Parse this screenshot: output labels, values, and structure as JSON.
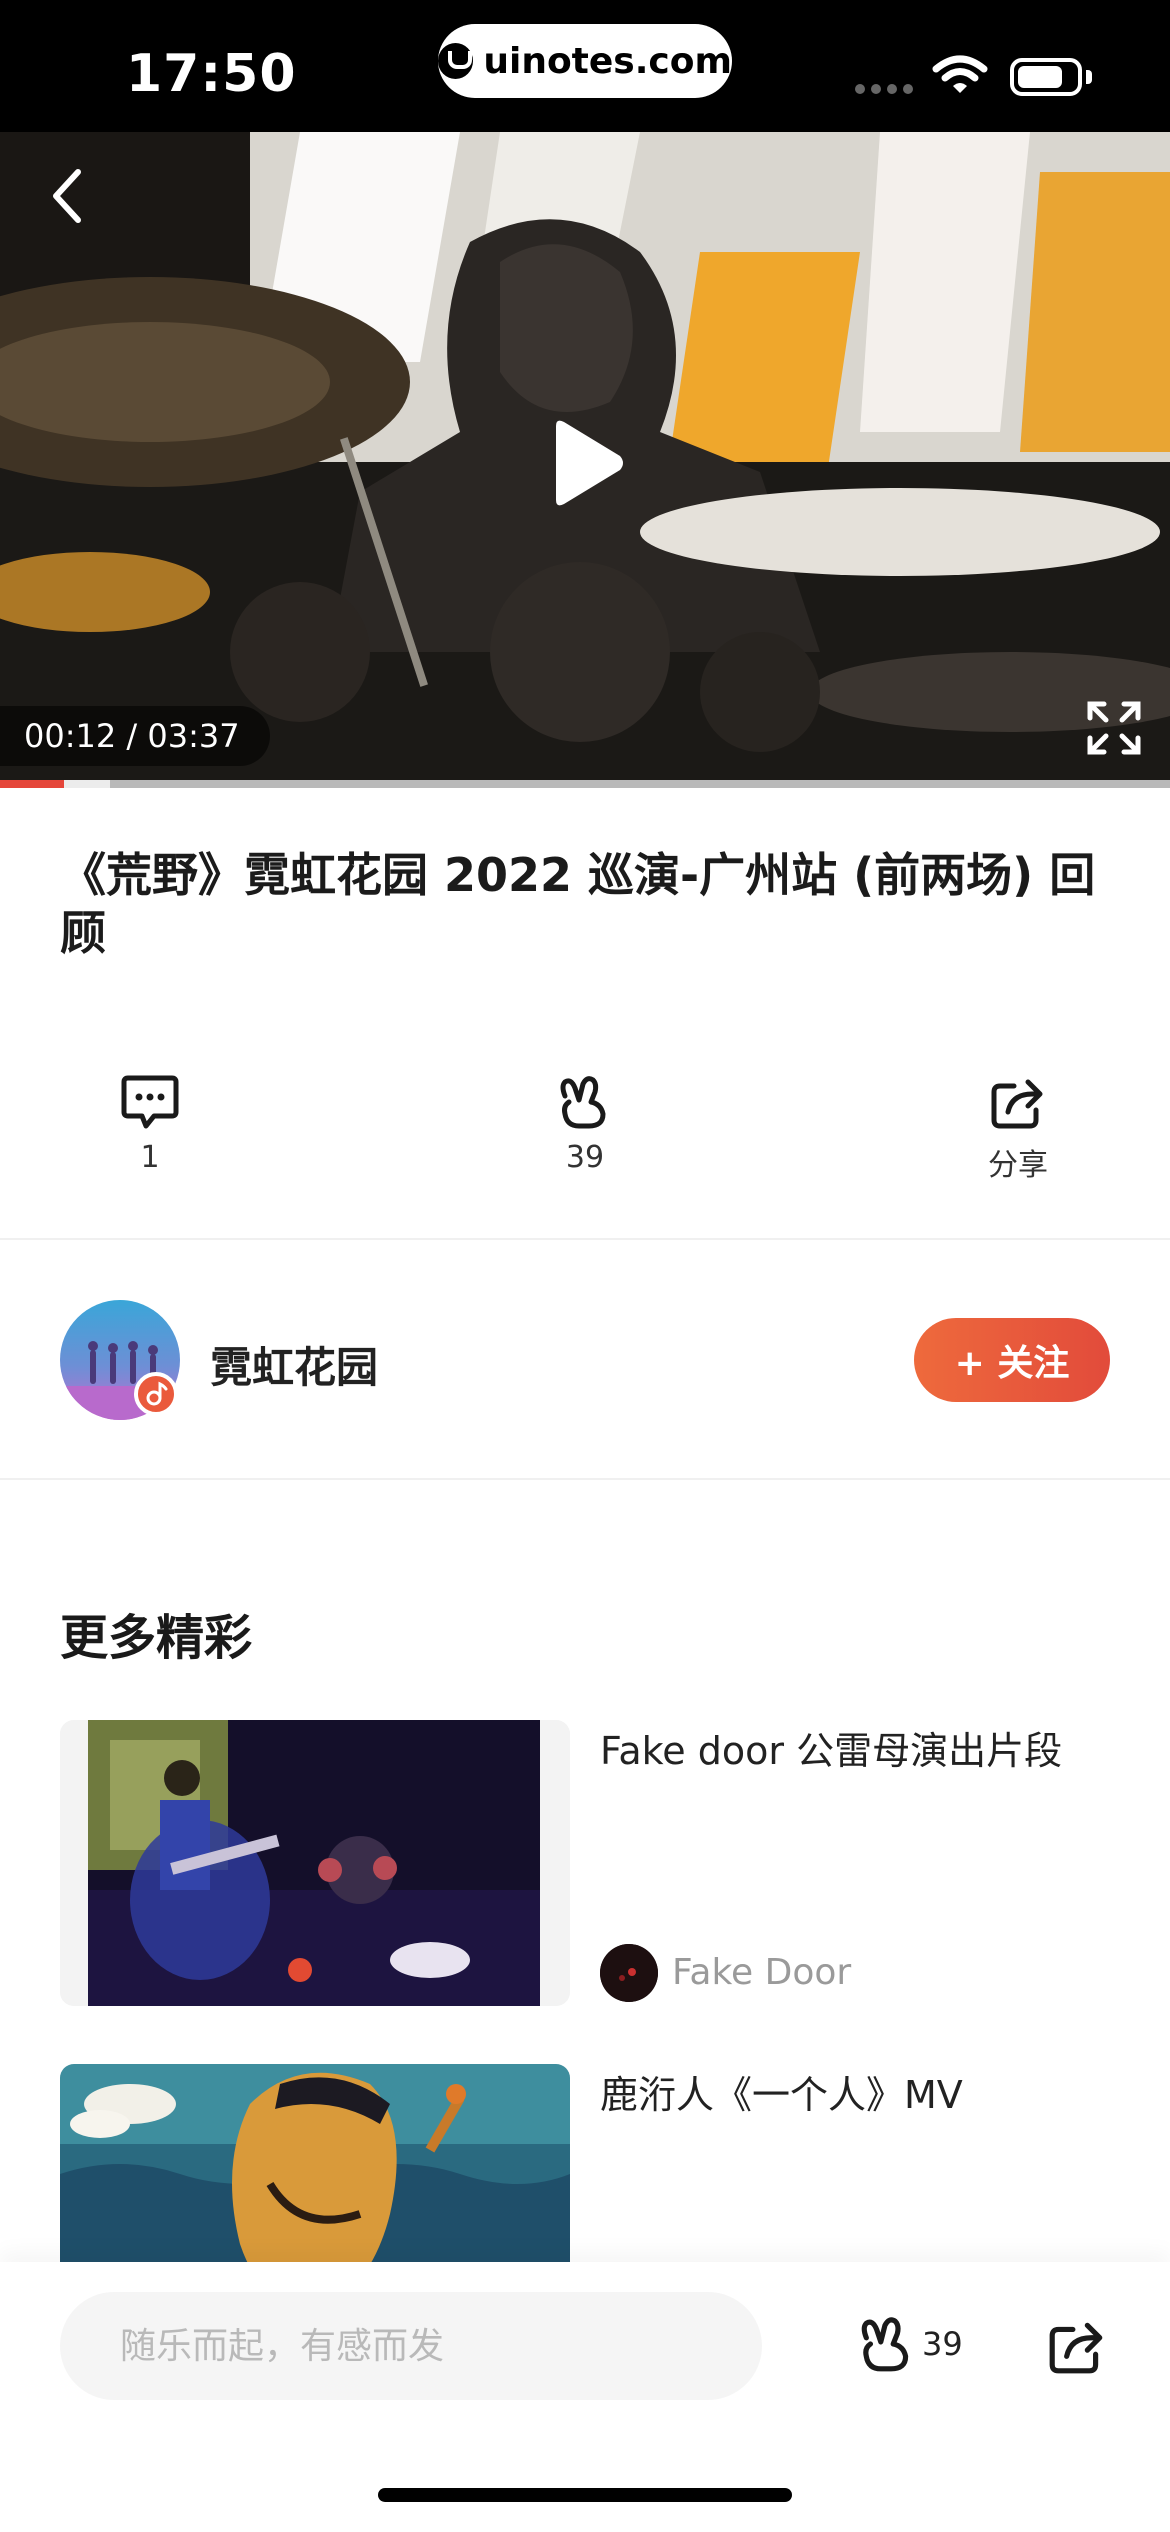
{
  "status_bar": {
    "time": "17:50",
    "url": "uinotes.com"
  },
  "player": {
    "elapsed": "00:12",
    "duration": "03:37",
    "time_display": "00:12 / 03:37",
    "progress_percent": 5.5,
    "buffered_percent": 9.4
  },
  "video": {
    "title": "《荒野》霓虹花园 2022 巡演-广州站 (前两场) 回顾"
  },
  "actions": {
    "comment": {
      "count": "1"
    },
    "like": {
      "count": "39"
    },
    "share": {
      "label": "分享"
    }
  },
  "artist": {
    "name": "霓虹花园",
    "follow_label": "+ 关注"
  },
  "more": {
    "title": "更多精彩",
    "items": [
      {
        "title": "Fake door 公雷母演出片段",
        "author": "Fake Door"
      },
      {
        "title": "鹿洐人《一个人》MV",
        "author": ""
      }
    ]
  },
  "bottom_bar": {
    "comment_placeholder": "随乐而起，有感而发",
    "like_count": "39"
  },
  "colors": {
    "accent": "#e5463a",
    "follow_button": "#ea5a3c"
  }
}
